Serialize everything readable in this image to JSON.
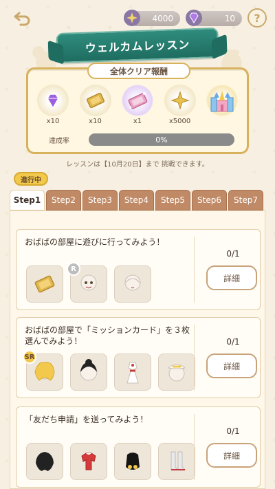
{
  "header": {
    "coins": "4000",
    "gems": "10"
  },
  "banner": {
    "title": "ウェルカムレッスン"
  },
  "reward_panel": {
    "title": "全体クリア報酬",
    "items": [
      {
        "icon": "gem-icon",
        "qty": "x10"
      },
      {
        "icon": "gold-ticket-icon",
        "qty": "x10"
      },
      {
        "icon": "pink-ticket-icon",
        "qty": "x1"
      },
      {
        "icon": "star-icon",
        "qty": "x5000"
      },
      {
        "icon": "castle-icon",
        "qty": ""
      }
    ],
    "progress_label": "達成率",
    "progress_text": "0%",
    "progress_value": 0
  },
  "deadline_text": "レッスンは【10月20日】まで 挑戦できます。",
  "tabs": {
    "badge": "進行中",
    "items": [
      "Step1",
      "Step2",
      "Step3",
      "Step4",
      "Step5",
      "Step6",
      "Step7"
    ]
  },
  "missions": [
    {
      "title": "おばばの部屋に遊びに行ってみよう！",
      "count": "0/1",
      "detail_label": "詳細",
      "items": [
        {
          "icon": "gold-ticket-icon",
          "tag": ""
        },
        {
          "icon": "face-icon",
          "tag": "R"
        },
        {
          "icon": "hair-icon",
          "tag": ""
        }
      ]
    },
    {
      "title": "おばばの部屋で「ミッションカード」を３枚選んでみよう！",
      "count": "0/1",
      "detail_label": "詳細",
      "items": [
        {
          "icon": "blonde-hair-icon",
          "tag": "SR"
        },
        {
          "icon": "black-hair-icon",
          "tag": ""
        },
        {
          "icon": "dress-icon",
          "tag": ""
        },
        {
          "icon": "hat-icon",
          "tag": ""
        }
      ]
    },
    {
      "title": "「友だち申請」を送ってみよう！",
      "count": "0/1",
      "detail_label": "詳細",
      "items": [
        {
          "icon": "black-hair-icon",
          "tag": ""
        },
        {
          "icon": "red-top-icon",
          "tag": ""
        },
        {
          "icon": "black-outfit-icon",
          "tag": ""
        },
        {
          "icon": "boots-icon",
          "tag": ""
        }
      ]
    }
  ]
}
